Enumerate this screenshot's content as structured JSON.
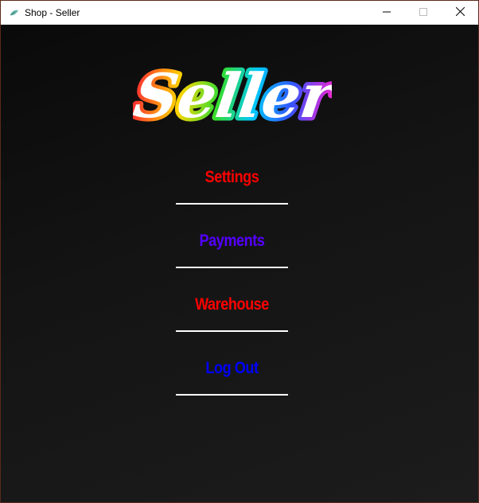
{
  "window": {
    "title": "Shop - Seller",
    "app_icon": "leaf-icon",
    "controls": [
      "minimize-icon",
      "maximize-icon",
      "close-icon"
    ]
  },
  "logo": {
    "text": "Seller",
    "stroke_gradient": [
      "#ff3030",
      "#ffd400",
      "#33dd33",
      "#00c8ff",
      "#3355ff",
      "#ff22cc"
    ]
  },
  "menu": {
    "items": [
      {
        "label": "Settings",
        "color": "#ff0000"
      },
      {
        "label": "Payments",
        "color": "#5500ff"
      },
      {
        "label": "Warehouse",
        "color": "#ff0000"
      },
      {
        "label": "Log Out",
        "color": "#0000ff"
      }
    ]
  }
}
